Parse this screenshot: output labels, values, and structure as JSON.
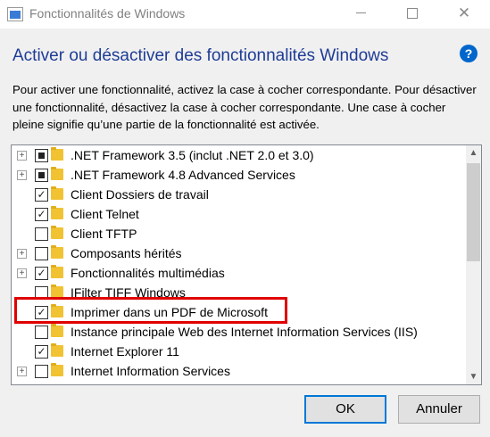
{
  "window": {
    "title": "Fonctionnalités de Windows",
    "close_glyph": "✕"
  },
  "header": {
    "heading": "Activer ou désactiver des fonctionnalités Windows",
    "help_glyph": "?"
  },
  "description": "Pour activer une fonctionnalité, activez la case à cocher correspondante. Pour désactiver une fonctionnalité, désactivez la case à cocher correspondante. Une case à cocher pleine signifie qu’une partie de la fonctionnalité est activée.",
  "features": [
    {
      "label": ".NET Framework 3.5 (inclut .NET 2.0 et 3.0)",
      "expandable": true,
      "state": "partial"
    },
    {
      "label": ".NET Framework 4.8 Advanced Services",
      "expandable": true,
      "state": "partial"
    },
    {
      "label": "Client Dossiers de travail",
      "expandable": false,
      "state": "checked"
    },
    {
      "label": "Client Telnet",
      "expandable": false,
      "state": "checked"
    },
    {
      "label": "Client TFTP",
      "expandable": false,
      "state": "unchecked"
    },
    {
      "label": "Composants hérités",
      "expandable": true,
      "state": "unchecked"
    },
    {
      "label": "Fonctionnalités multimédias",
      "expandable": true,
      "state": "checked"
    },
    {
      "label": "IFilter TIFF Windows",
      "expandable": false,
      "state": "unchecked"
    },
    {
      "label": "Imprimer dans un PDF de Microsoft",
      "expandable": false,
      "state": "checked"
    },
    {
      "label": "Instance principale Web des Internet Information Services (IIS)",
      "expandable": false,
      "state": "unchecked"
    },
    {
      "label": "Internet Explorer 11",
      "expandable": false,
      "state": "checked"
    },
    {
      "label": "Internet Information Services",
      "expandable": true,
      "state": "unchecked"
    }
  ],
  "glyphs": {
    "check": "✓",
    "expand": "+",
    "scroll_up": "▲",
    "scroll_down": "▼"
  },
  "buttons": {
    "ok": "OK",
    "cancel": "Annuler"
  },
  "colors": {
    "accent": "#0078d7",
    "highlight": "#e00000",
    "heading": "#1e3c96"
  }
}
